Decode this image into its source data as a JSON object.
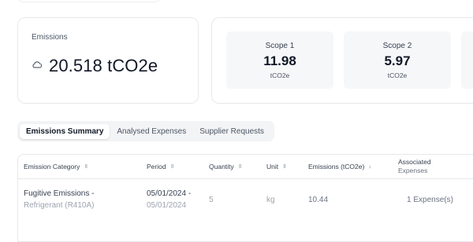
{
  "emissions": {
    "label": "Emissions",
    "value": "20.518 tCO2e",
    "icon": "cloud-icon"
  },
  "scopes": [
    {
      "title": "Scope 1",
      "value": "11.98",
      "unit": "tCO2e"
    },
    {
      "title": "Scope 2",
      "value": "5.97",
      "unit": "tCO2e"
    }
  ],
  "tabs": [
    {
      "label": "Emissions Summary",
      "active": true
    },
    {
      "label": "Analysed Expenses",
      "active": false
    },
    {
      "label": "Supplier Requests",
      "active": false
    }
  ],
  "table": {
    "headers": {
      "category": "Emission Category",
      "period": "Period",
      "quantity": "Quantity",
      "unit": "Unit",
      "emissions": "Emissions (tCO2e)",
      "associated_line1": "Associated",
      "associated_line2": "Expenses"
    },
    "rows": [
      {
        "category": "Fugitive Emissions -",
        "subcategory": "Refrigerant (R410A)",
        "period_start": "05/01/2024 -",
        "period_end": "05/01/2024",
        "quantity": "5",
        "unit": "kg",
        "emissions": "10.44",
        "associated": "1 Expense(s)"
      }
    ]
  },
  "colors": {
    "border": "#e6e8ec",
    "scope_bg": "#f6f7f9",
    "tabs_bg": "#f3f4f6",
    "text": "#111827"
  }
}
